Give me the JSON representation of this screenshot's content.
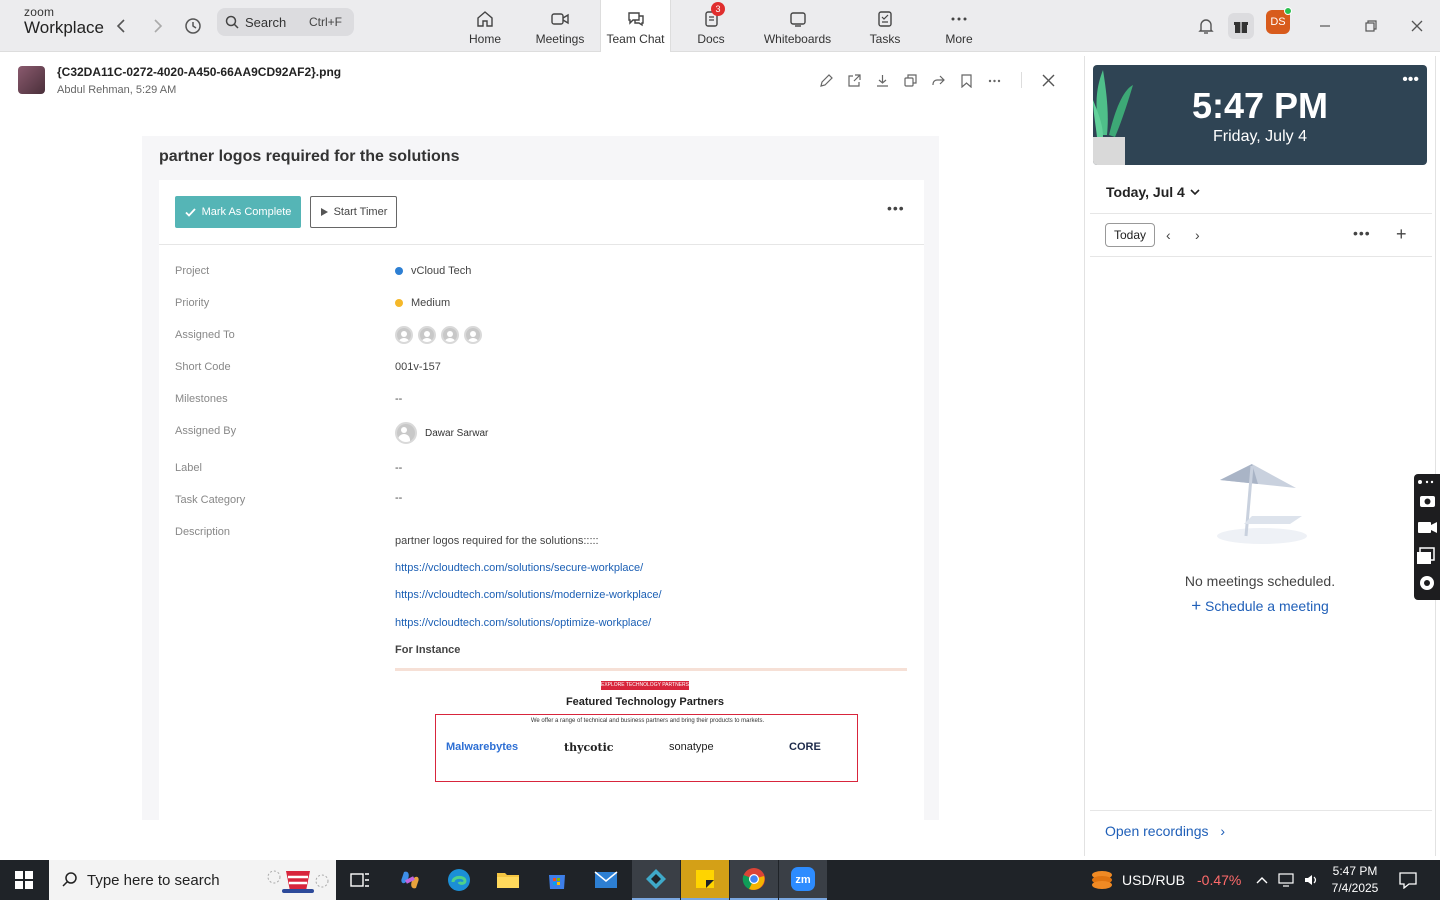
{
  "app": {
    "brand_top": "zoom",
    "brand_bottom": "Workplace"
  },
  "search": {
    "label": "Search",
    "shortcut": "Ctrl+F"
  },
  "nav": {
    "tabs": [
      {
        "label": "Home"
      },
      {
        "label": "Meetings"
      },
      {
        "label": "Team Chat"
      },
      {
        "label": "Docs",
        "badge": "3"
      },
      {
        "label": "Whiteboards"
      },
      {
        "label": "Tasks"
      },
      {
        "label": "More"
      }
    ],
    "active": "Team Chat"
  },
  "user": {
    "initials": "DS",
    "status_color": "#2bbf4f"
  },
  "file": {
    "name": "{C32DA11C-0272-4020-A450-66AA9CD92AF2}.png",
    "meta": "Abdul Rehman, 5:29 AM"
  },
  "task": {
    "title": "partner logos required for the solutions",
    "mark_complete": "Mark As Complete",
    "start_timer": "Start Timer",
    "fields": {
      "project_label": "Project",
      "project_value": "vCloud Tech",
      "project_color": "#2d7fd3",
      "priority_label": "Priority",
      "priority_value": "Medium",
      "priority_color": "#f5b829",
      "assigned_to_label": "Assigned To",
      "short_code_label": "Short Code",
      "short_code_value": "001v-157",
      "milestones_label": "Milestones",
      "milestones_value": "--",
      "assigned_by_label": "Assigned By",
      "assigned_by_value": "Dawar Sarwar",
      "label_label": "Label",
      "label_value": "--",
      "task_category_label": "Task Category",
      "task_category_value": "--",
      "description_label": "Description"
    },
    "description": {
      "intro": "partner logos required for the solutions:::::",
      "links": [
        "https://vcloudtech.com/solutions/secure-workplace/",
        "https://vcloudtech.com/solutions/modernize-workplace/",
        "https://vcloudtech.com/solutions/optimize-workplace/"
      ],
      "for_instance": "For Instance"
    },
    "embed": {
      "ribbon": "EXPLORE TECHNOLOGY PARTNERS",
      "heading": "Featured Technology Partners",
      "sub": "We offer a range of technical and business partners and bring their products to markets.",
      "logos": [
        "Malwarebytes",
        "thycotic",
        "sonatype",
        "CORE"
      ]
    }
  },
  "calendar": {
    "time": "5:47 PM",
    "date": "Friday, July 4",
    "header": "Today, Jul 4",
    "today_button": "Today",
    "empty": "No meetings scheduled.",
    "schedule": "Schedule a meeting",
    "open_recordings": "Open recordings"
  },
  "taskbar": {
    "search_placeholder": "Type here to search",
    "ticker_name": "USD/RUB",
    "ticker_change": "-0.47%",
    "ticker_color": "#ff6b6b",
    "time": "5:47 PM",
    "date": "7/4/2025"
  }
}
